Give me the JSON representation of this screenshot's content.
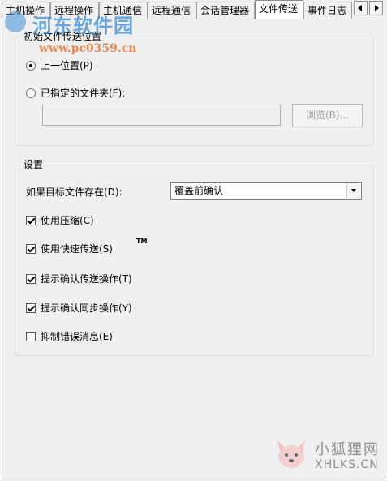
{
  "tabs": [
    {
      "label": "主机操作",
      "active": false
    },
    {
      "label": "远程操作",
      "active": false
    },
    {
      "label": "主机通信",
      "active": false
    },
    {
      "label": "远程通信",
      "active": false
    },
    {
      "label": "会话管理器",
      "active": false
    },
    {
      "label": "文件传送",
      "active": true
    },
    {
      "label": "事件日志",
      "active": false
    }
  ],
  "location_group": {
    "title": "初始文件传送位置",
    "options": [
      {
        "label": "上一位置(P)",
        "selected": true
      },
      {
        "label": "已指定的文件夹(F):",
        "selected": false
      }
    ],
    "folder_value": "",
    "browse_label": "浏览(B)..."
  },
  "settings_group": {
    "title": "设置",
    "exists_label": "如果目标文件存在(D):",
    "exists_value": "覆盖前确认",
    "checks": [
      {
        "label": "使用压缩(C)",
        "checked": true
      },
      {
        "label": "使用快速传送(S)",
        "checked": true
      },
      {
        "label": "提示确认传送操作(T)",
        "checked": true
      },
      {
        "label": "提示确认同步操作(Y)",
        "checked": true
      },
      {
        "label": "抑制错误消息(E)",
        "checked": false
      }
    ],
    "trademark": "TM"
  },
  "watermarks": {
    "top_name": "河东软件园",
    "top_url": "www.pc0359.cn",
    "bottom_name": "小狐狸网",
    "bottom_url": "XHLKS.CN"
  },
  "colors": {
    "active_tab": "#ffffff",
    "panel_bg": "#f0f0f0",
    "group_border": "#d5dfe5",
    "disabled_text": "#a0a0a0"
  }
}
